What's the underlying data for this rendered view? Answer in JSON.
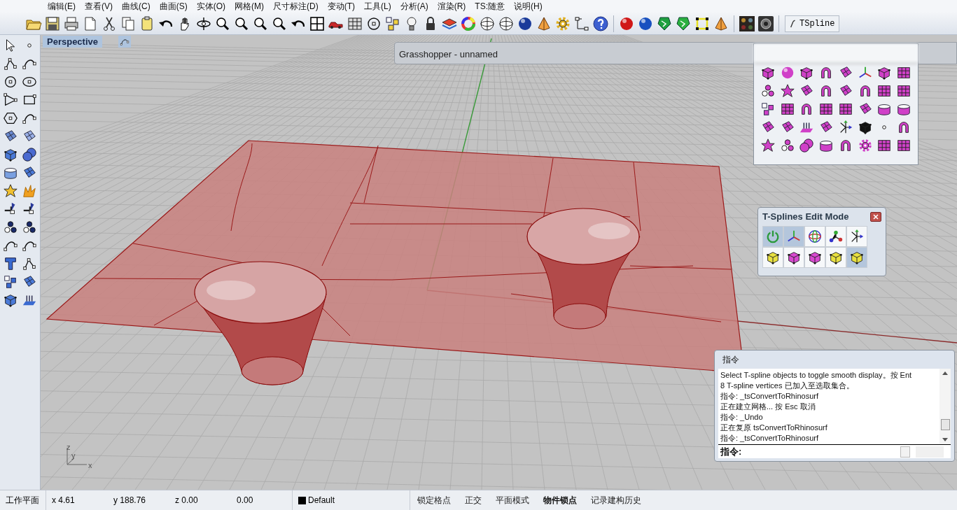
{
  "menu": [
    "编辑(E)",
    "查看(V)",
    "曲线(C)",
    "曲面(S)",
    "实体(O)",
    "网格(M)",
    "尺寸标注(D)",
    "变动(T)",
    "工具(L)",
    "分析(A)",
    "渲染(R)",
    "TS:随意",
    "说明(H)"
  ],
  "toolbar_button": {
    "label": "TSpline"
  },
  "viewport": {
    "title": "Perspective",
    "axis_labels": [
      "z",
      "y",
      "x"
    ]
  },
  "grasshopper": {
    "title": "Grasshopper - unnamed"
  },
  "tsplines_panel": {
    "title": "T-Splines Edit Mode",
    "tools": [
      {
        "selected": true
      },
      {
        "selected": true
      },
      {
        "selected": false
      },
      {
        "selected": false
      },
      {
        "selected": false
      },
      {
        "selected": false
      },
      {
        "selected": false
      },
      {
        "selected": false
      },
      {
        "selected": false
      },
      {
        "selected": true
      }
    ]
  },
  "command_panel": {
    "title": "指令",
    "history": [
      "Select T-spline objects to toggle smooth display。按 Ent",
      "8 T-spline vertices 已加入至选取集合。",
      "指令: _tsConvertToRhinosurf",
      "正在建立网格... 按 Esc 取消",
      "指令: _Undo",
      "正在复原 tsConvertToRhinosurf",
      "指令: _tsConvertToRhinosurf"
    ],
    "prompt": "指令:"
  },
  "status_bar": {
    "cplane": "工作平面",
    "x": "x 4.61",
    "y": "y 188.76",
    "z": "z 0.00",
    "distance": "0.00",
    "layer": {
      "name": "Default",
      "color": "#000000"
    },
    "toggles": [
      {
        "label": "锁定格点",
        "on": false
      },
      {
        "label": "正交",
        "on": false
      },
      {
        "label": "平面模式",
        "on": false
      },
      {
        "label": "物件锁点",
        "on": true
      },
      {
        "label": "记录建构历史",
        "on": false
      }
    ]
  }
}
